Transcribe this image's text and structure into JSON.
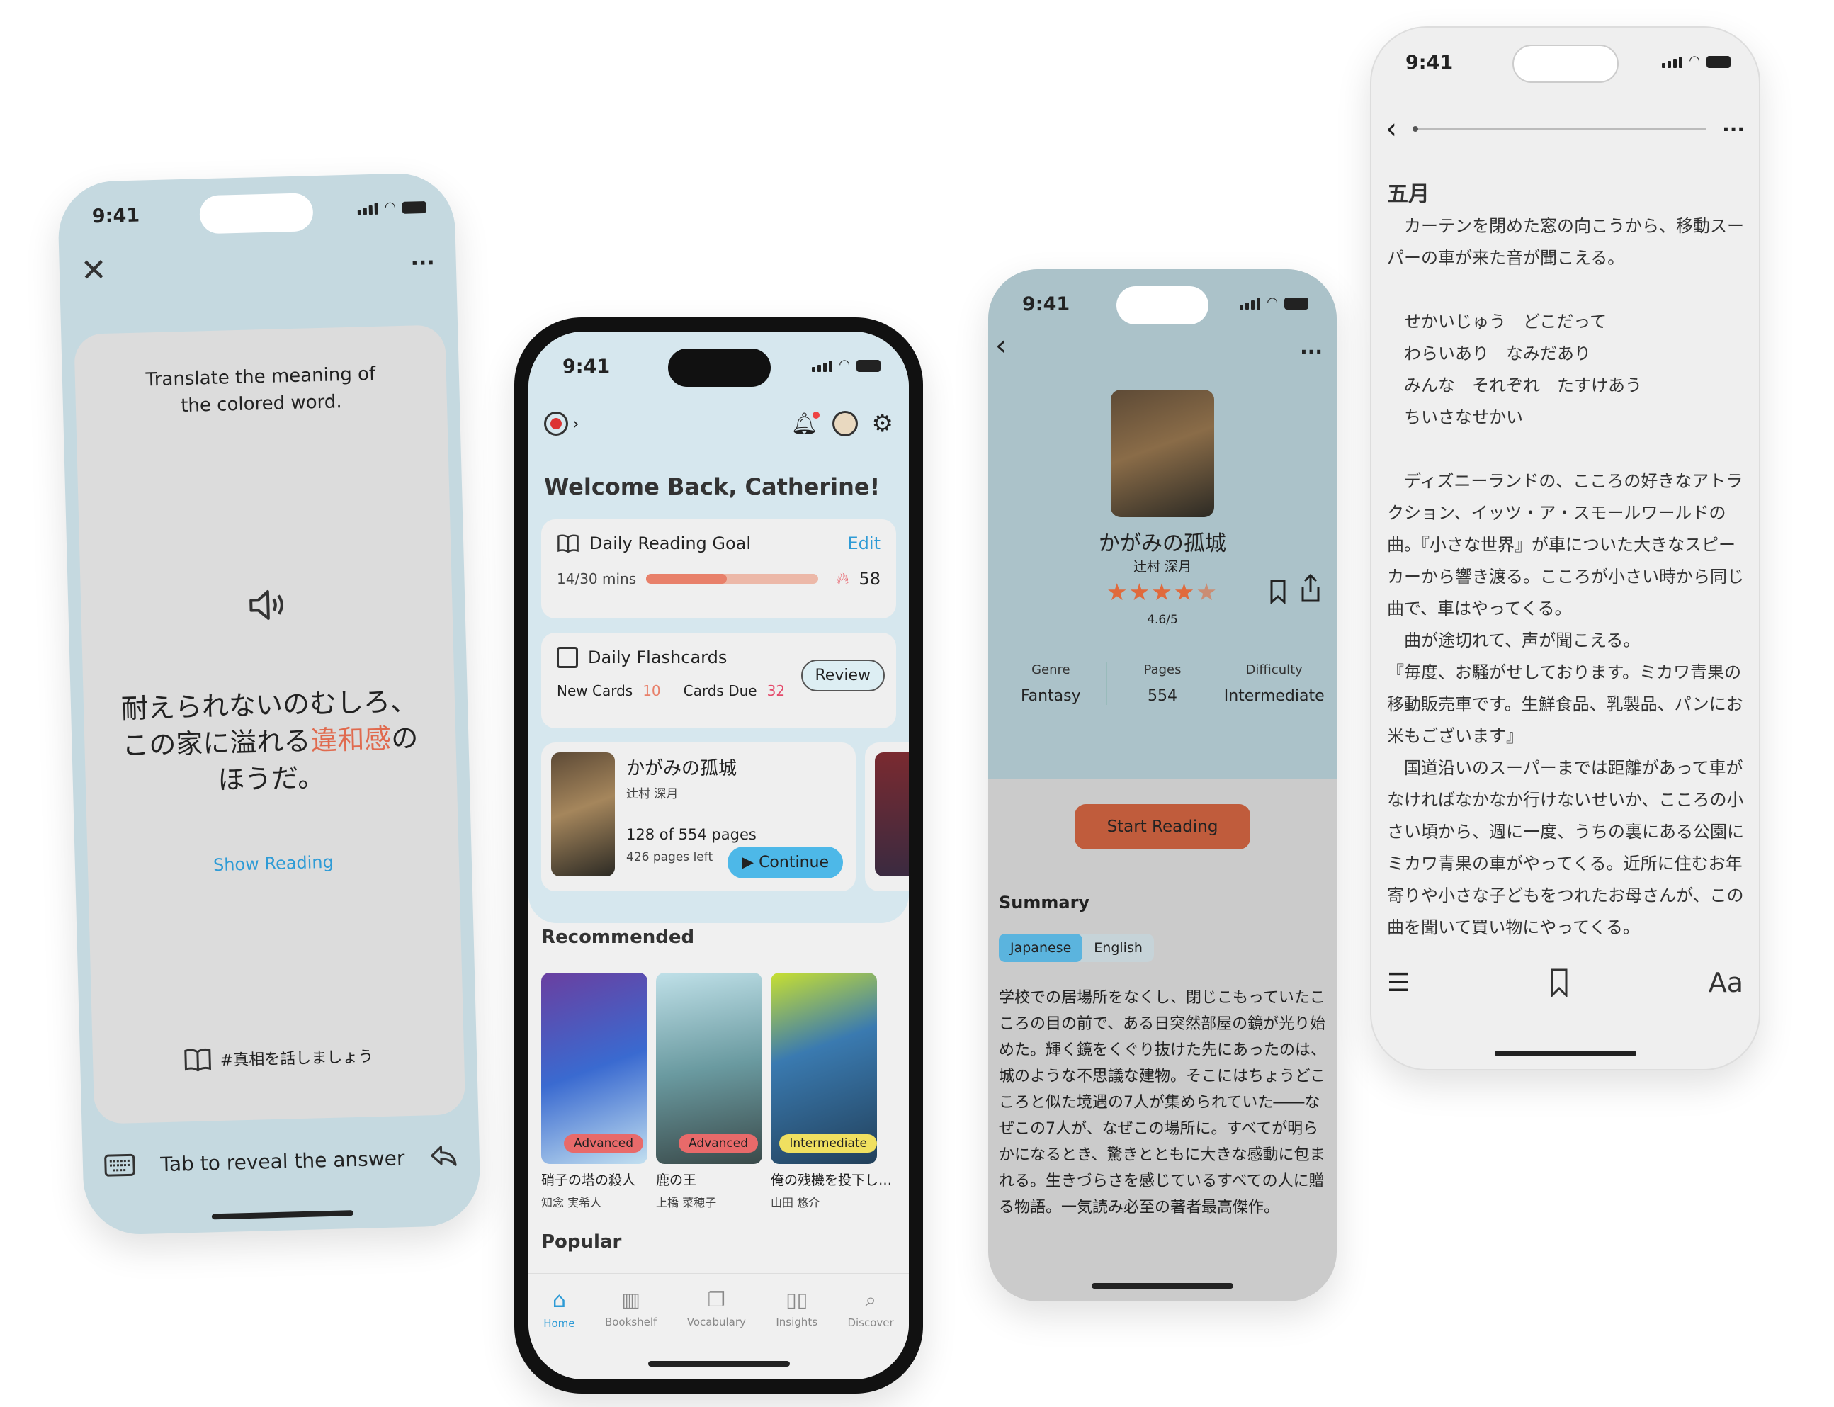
{
  "status": {
    "time": "9:41"
  },
  "flashcard": {
    "prompt": "Translate the meaning of the colored word.",
    "sentence_before": "耐えられないのむしろ、この家に溢れる",
    "sentence_highlight": "違和感",
    "sentence_after": "のほうだ。",
    "show_reading": "Show Reading",
    "source_tag": "#真相を話しましょう",
    "reveal_hint": "Tab to reveal the answer",
    "highlight_color": "#e06a4e"
  },
  "home": {
    "welcome": "Welcome Back, Catherine!",
    "reading_goal": {
      "title": "Daily Reading Goal",
      "edit": "Edit",
      "progress_text": "14/30 mins",
      "progress": 0.47,
      "streak": "58"
    },
    "flashcards": {
      "title": "Daily Flashcards",
      "new_label": "New Cards",
      "new_count": "10",
      "due_label": "Cards Due",
      "due_count": "32",
      "review": "Review"
    },
    "current_book": {
      "title": "かがみの孤城",
      "author": "辻村 深月",
      "pages": "128 of 554 pages",
      "left": "426 pages left",
      "continue": "Continue"
    },
    "recommended_title": "Recommended",
    "recommended": [
      {
        "title": "硝子の塔の殺人",
        "author": "知念 実希人",
        "level": "Advanced"
      },
      {
        "title": "鹿の王",
        "author": "上橋 菜穂子",
        "level": "Advanced"
      },
      {
        "title": "俺の残機を投下し…",
        "author": "山田 悠介",
        "level": "Intermediate"
      }
    ],
    "popular_title": "Popular",
    "tabs": [
      {
        "label": "Home",
        "icon": "home-icon",
        "active": true
      },
      {
        "label": "Bookshelf",
        "icon": "bookshelf-icon"
      },
      {
        "label": "Vocabulary",
        "icon": "vocabulary-icon"
      },
      {
        "label": "Insights",
        "icon": "insights-icon"
      },
      {
        "label": "Discover",
        "icon": "search-icon"
      }
    ],
    "accent": "#2e9bd6"
  },
  "detail": {
    "title": "かがみの孤城",
    "author": "辻村 深月",
    "rating": "4.6/5",
    "rating_value": 4.6,
    "stats": [
      {
        "label": "Genre",
        "value": "Fantasy"
      },
      {
        "label": "Pages",
        "value": "554"
      },
      {
        "label": "Difficulty",
        "value": "Intermediate"
      }
    ],
    "start_reading": "Start Reading",
    "summary_title": "Summary",
    "lang_tabs": [
      "Japanese",
      "English"
    ],
    "summary": "学校での居場所をなくし、閉じこもっていたこころの目の前で、ある日突然部屋の鏡が光り始めた。輝く鏡をくぐり抜けた先にあったのは、城のような不思議な建物。そこにはちょうどこころと似た境遇の7人が集められていた――なぜこの7人が、なぜこの場所に。すべてが明らかになるとき、驚きとともに大きな感動に包まれる。生きづらさを感じているすべての人に贈る物語。一気読み必至の著者最高傑作。",
    "button_color": "#c05c3c"
  },
  "reader": {
    "chapter": "五月",
    "text": "　カーテンを閉めた窓の向こうから、移動スーパーの車が来た音が聞こえる。\n\n　せかいじゅう　どこだって\n　わらいあり　なみだあり\n　みんな　それぞれ　たすけあう\n　ちいさなせかい\n\n　ディズニーランドの、こころの好きなアトラクション、イッツ・ア・スモールワールドの曲。『小さな世界』が車についた大きなスピーカーから響き渡る。こころが小さい時から同じ曲で、車はやってくる。\n　曲が途切れて、声が聞こえる。\n『毎度、お騒がせしております。ミカワ青果の移動販売車です。生鮮食品、乳製品、パンにお米もございます』\n　国道沿いのスーパーまでは距離があって車がなければなかなか行けないせいか、こころの小さい頃から、週に一度、うちの裏にある公園にミカワ青果の車がやってくる。近所に住むお年寄りや小さな子どもをつれたお母さんが、この曲を聞いて買い物にやってくる。",
    "font_button": "Aa"
  }
}
